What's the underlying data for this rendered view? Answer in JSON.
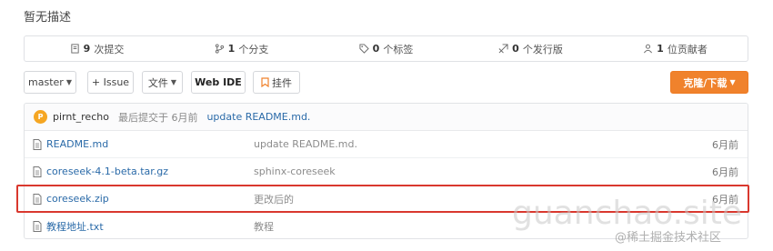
{
  "repo": {
    "description": "暂无描述"
  },
  "stats": [
    {
      "icon": "commit-icon",
      "count": "9",
      "label": "次提交"
    },
    {
      "icon": "branch-icon",
      "count": "1",
      "label": "个分支"
    },
    {
      "icon": "tag-icon",
      "count": "0",
      "label": "个标签"
    },
    {
      "icon": "release-icon",
      "count": "0",
      "label": "个发行版"
    },
    {
      "icon": "contributor-icon",
      "count": "1",
      "label": "位贡献者"
    }
  ],
  "toolbar": {
    "branch": "master",
    "issue": "+ Issue",
    "files": "文件",
    "webide": "Web IDE",
    "pin": "挂件",
    "clone": "克隆/下载"
  },
  "last_commit": {
    "avatar_letter": "P",
    "author": "pirnt_recho",
    "time": "最后提交于 6月前",
    "message": "update README.md."
  },
  "files": [
    {
      "name": "README.md",
      "message": "update README.md.",
      "date": "6月前"
    },
    {
      "name": "coreseek-4.1-beta.tar.gz",
      "message": "sphinx-coreseek",
      "date": "6月前"
    },
    {
      "name": "coreseek.zip",
      "message": "更改后的",
      "date": "6月前"
    },
    {
      "name": "教程地址.txt",
      "message": "教程",
      "date": ""
    }
  ],
  "watermark": {
    "main": "guanchao.site",
    "sub": "@稀土掘金技术社区"
  },
  "colors": {
    "accent": "#f0822c",
    "link": "#2a6aa8",
    "highlight": "#d9382e"
  }
}
